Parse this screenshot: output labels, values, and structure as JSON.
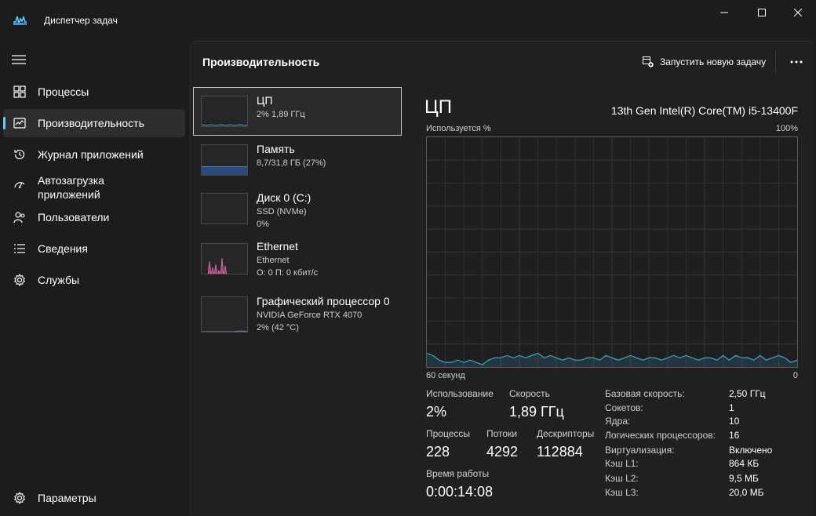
{
  "window": {
    "title": "Диспетчер задач"
  },
  "sidebar": {
    "items": [
      {
        "label": "Процессы",
        "icon": "processes-icon"
      },
      {
        "label": "Производительность",
        "icon": "performance-icon",
        "active": true
      },
      {
        "label": "Журнал приложений",
        "icon": "history-icon"
      },
      {
        "label": "Автозагрузка приложений",
        "icon": "startup-icon"
      },
      {
        "label": "Пользователи",
        "icon": "users-icon"
      },
      {
        "label": "Сведения",
        "icon": "details-icon"
      },
      {
        "label": "Службы",
        "icon": "services-icon"
      }
    ],
    "settings_label": "Параметры"
  },
  "header": {
    "title": "Производительность",
    "run_task_label": "Запустить новую задачу"
  },
  "resources": [
    {
      "name": "ЦП",
      "sub1": "2%  1,89 ГГц",
      "sub2": ""
    },
    {
      "name": "Память",
      "sub1": "8,7/31,8 ГБ (27%)",
      "sub2": ""
    },
    {
      "name": "Диск 0 (C:)",
      "sub1": "SSD (NVMe)",
      "sub2": "0%"
    },
    {
      "name": "Ethernet",
      "sub1": "Ethernet",
      "sub2": "О: 0 П: 0 кбит/с"
    },
    {
      "name": "Графический процессор 0",
      "sub1": "NVIDIA GeForce RTX 4070",
      "sub2": "2%  (42 °C)"
    }
  ],
  "detail": {
    "title": "ЦП",
    "model": "13th Gen Intel(R) Core(TM) i5-13400F",
    "graph_label_left": "Используется %",
    "graph_label_right": "100%",
    "graph_bottom_left": "60 секунд",
    "graph_bottom_right": "0",
    "graph_values_percent": [
      6,
      5,
      3,
      2,
      2,
      3,
      2,
      3,
      2,
      1,
      3,
      4,
      4,
      5,
      4,
      5,
      4,
      5,
      6,
      4,
      5,
      4,
      3,
      4,
      3,
      3,
      4,
      4,
      3,
      5,
      4,
      3,
      4,
      5,
      4,
      3,
      4,
      4,
      3,
      4,
      5,
      4,
      5,
      4,
      3,
      4,
      4,
      3,
      5,
      3,
      5,
      4,
      4,
      3,
      5,
      3,
      4,
      5,
      4,
      2,
      3
    ],
    "stats": {
      "usage_label": "Использование",
      "usage_value": "2%",
      "speed_label": "Скорость",
      "speed_value": "1,89 ГГц",
      "processes_label": "Процессы",
      "processes_value": "228",
      "threads_label": "Потоки",
      "threads_value": "4292",
      "handles_label": "Дескрипторы",
      "handles_value": "112884",
      "uptime_label": "Время работы",
      "uptime_value": "0:00:14:08"
    },
    "specs": [
      {
        "key": "Базовая скорость:",
        "value": "2,50 ГГц"
      },
      {
        "key": "Сокетов:",
        "value": "1"
      },
      {
        "key": "Ядра:",
        "value": "10"
      },
      {
        "key": "Логических процессоров:",
        "value": "16"
      },
      {
        "key": "Виртуализация:",
        "value": "Включено"
      },
      {
        "key": "Кэш L1:",
        "value": "864 КБ"
      },
      {
        "key": "Кэш L2:",
        "value": "9,5 МБ"
      },
      {
        "key": "Кэш L3:",
        "value": "20,0 МБ"
      }
    ]
  },
  "colors": {
    "accent": "#60cdff",
    "cpu_line": "#3fa3c9",
    "memory_fill": "#2a4a7a",
    "network_fill": "#c84a8a"
  }
}
